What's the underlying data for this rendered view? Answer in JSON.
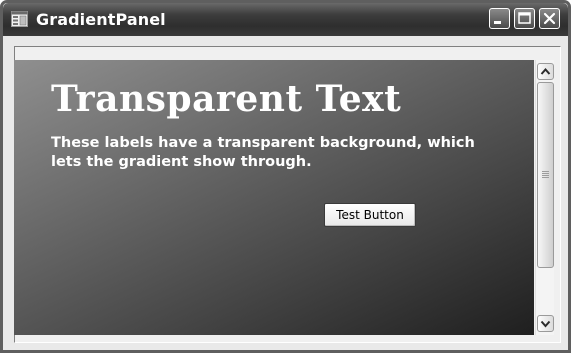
{
  "window": {
    "title": "GradientPanel",
    "icons": {
      "app": "window-app-icon",
      "minimize": "minimize-icon",
      "maximize": "maximize-icon",
      "close": "close-icon"
    }
  },
  "panel": {
    "heading": "Transparent Text",
    "description": "These labels have a transparent background, which lets the gradient show through.",
    "button_label": "Test Button"
  },
  "scrollbar": {
    "up_icon": "scroll-up-arrow-icon",
    "down_icon": "scroll-down-arrow-icon"
  },
  "colors": {
    "titlebar": "#2e2e2e",
    "gradient_light": "#8f8f8f",
    "gradient_dark": "#1f1f1f",
    "text": "#ffffff"
  }
}
